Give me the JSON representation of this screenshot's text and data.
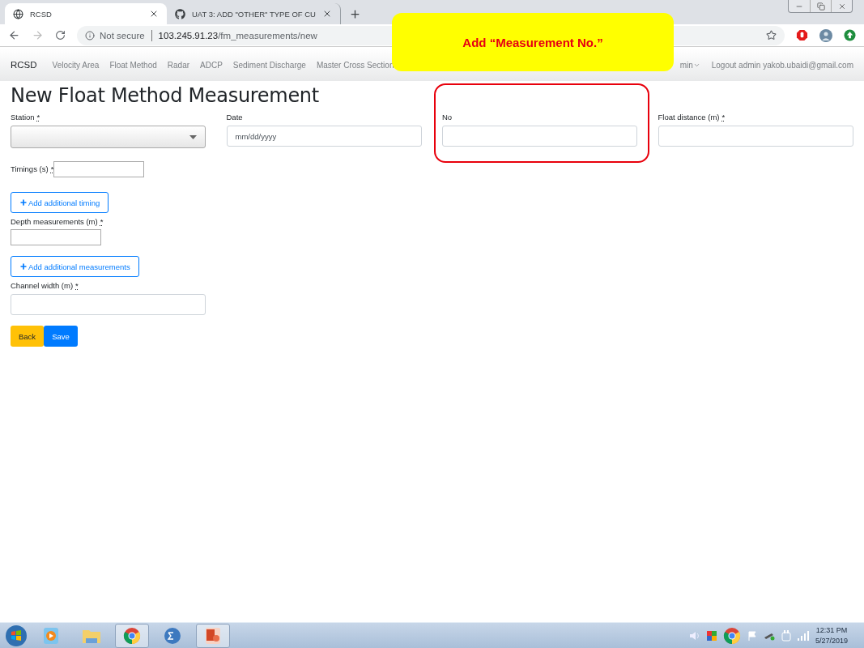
{
  "browser": {
    "tabs": [
      {
        "title": "RCSD",
        "kind": "globe",
        "selected": true
      },
      {
        "title": "UAT 3: ADD \"OTHER\" TYPE OF CU",
        "kind": "github",
        "selected": false
      }
    ],
    "address": {
      "security": "Not secure",
      "host": "103.245.91.23",
      "path": "/fm_measurements/new"
    }
  },
  "navbar": {
    "brand": "RCSD",
    "links": [
      "Velocity Area",
      "Float Method",
      "Radar",
      "ADCP",
      "Sediment Discharge",
      "Master Cross Section"
    ],
    "user_menu": "min",
    "logout": "Logout admin yakob.ubaidi@gmail.com"
  },
  "callout": "Add “Measurement No.”",
  "page_title": "New Float Method Measurement",
  "top_fields": [
    {
      "label": "Station",
      "mark": "*",
      "kind": "select",
      "highlighted": false
    },
    {
      "label": "Date",
      "kind": "input",
      "placeholder": "mm/dd/yyyy",
      "highlighted": false
    },
    {
      "label": "No",
      "kind": "input",
      "highlighted": true
    },
    {
      "label": "Float distance (m)",
      "mark": "*",
      "kind": "input",
      "highlighted": false
    }
  ],
  "timings": {
    "label": "Timings (s)",
    "mark": "*"
  },
  "add_timing_button": "Add additional timing",
  "depth": {
    "label": "Depth measurements (m)",
    "mark": "*"
  },
  "add_measurement_button": "Add additional measurements",
  "channel_width": {
    "label": "Channel width (m)",
    "mark": "*"
  },
  "buttons": [
    {
      "label": "Back",
      "kind": "warning"
    },
    {
      "label": "Save",
      "kind": "primary"
    }
  ],
  "taskbar": {
    "apps": [
      {
        "kind": "media",
        "open": false
      },
      {
        "kind": "folder",
        "open": false
      },
      {
        "kind": "chrome",
        "open": true
      },
      {
        "kind": "math",
        "open": false
      },
      {
        "kind": "slides",
        "open": true
      }
    ],
    "time": "12:31 PM",
    "date": "5/27/2019"
  }
}
